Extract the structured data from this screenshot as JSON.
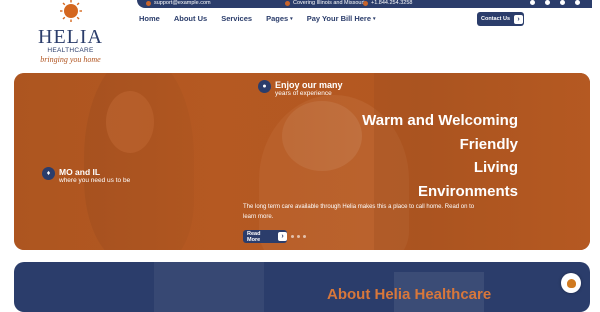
{
  "topbar": {
    "email": "support@example.com",
    "location": "Covering Illinois and Missouri",
    "phone": "+1.844.254.3258",
    "social_icons": [
      "facebook-icon",
      "x-icon",
      "instagram-icon",
      "pinterest-icon"
    ]
  },
  "logo": {
    "brand": "HELIA",
    "sub": "HEALTHCARE",
    "tagline": "bringing you home"
  },
  "nav": {
    "items": [
      {
        "label": "Home"
      },
      {
        "label": "About Us"
      },
      {
        "label": "Services"
      },
      {
        "label": "Pages"
      },
      {
        "label": "Pay Your Bill Here"
      }
    ],
    "contact_label": "Contact Us"
  },
  "hero": {
    "experience_title": "Enjoy our many",
    "experience_sub": "years of experience",
    "location_title": "MO and IL",
    "location_sub": "where you need us to be",
    "headline": [
      "Warm and Welcoming",
      "Friendly",
      "Living",
      "Environments"
    ],
    "description": "The long term care available through Helia makes this a place to call home. Read on to learn more.",
    "read_more": "Read More"
  },
  "about": {
    "title": "About Helia Healthcare"
  },
  "colors": {
    "navy": "#2b3d6b",
    "orange": "#b0531e",
    "accent": "#d7773b"
  }
}
